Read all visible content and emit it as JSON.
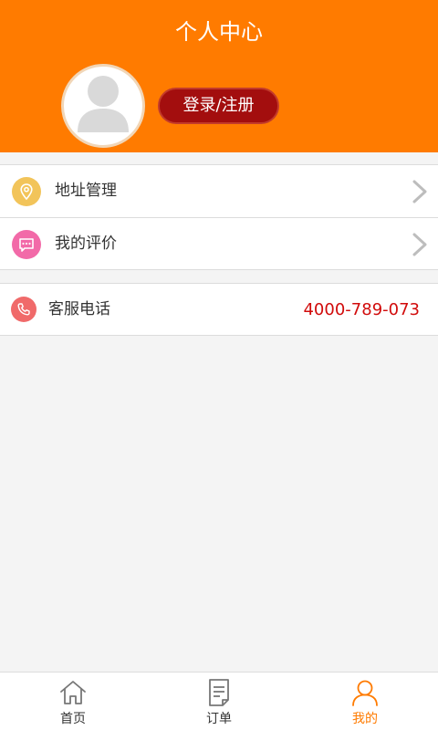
{
  "header": {
    "title": "个人中心",
    "login_label": "登录/注册",
    "background_color": "#ff7b00"
  },
  "menu": {
    "items": [
      {
        "label": "地址管理",
        "icon": "location-pin-icon",
        "icon_color": "#f2c45a"
      },
      {
        "label": "我的评价",
        "icon": "message-bubble-icon",
        "icon_color": "#f26aa8"
      }
    ]
  },
  "service": {
    "label": "客服电话",
    "phone": "4000-789-073",
    "icon": "phone-icon",
    "icon_color": "#f06a6a",
    "phone_color": "#d10b0b"
  },
  "tabbar": {
    "tabs": [
      {
        "label": "首页",
        "icon": "home-icon",
        "active": false
      },
      {
        "label": "订单",
        "icon": "order-document-icon",
        "active": false
      },
      {
        "label": "我的",
        "icon": "user-icon",
        "active": true
      }
    ],
    "active_color": "#ff7b00"
  }
}
